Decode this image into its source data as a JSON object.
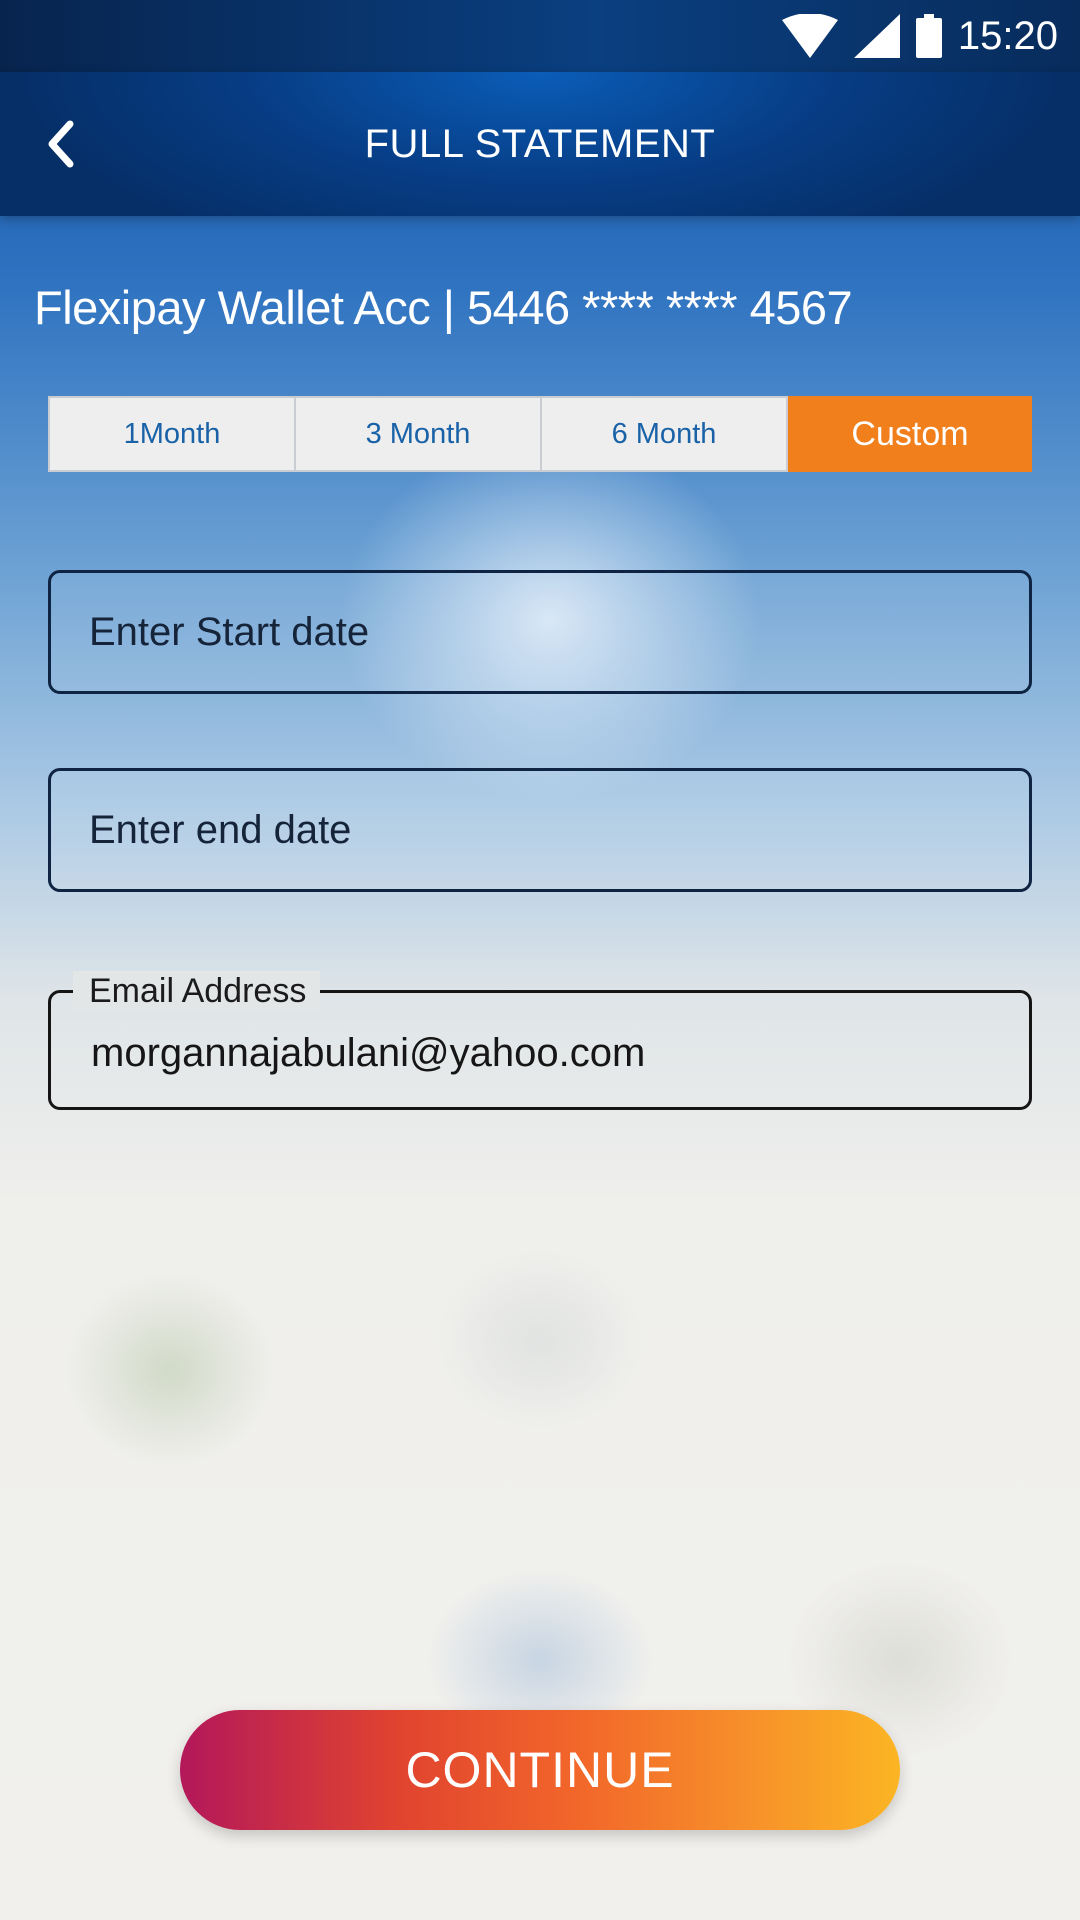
{
  "status_bar": {
    "time": "15:20"
  },
  "app_bar": {
    "title": "FULL STATEMENT"
  },
  "account": {
    "title": "Flexipay Wallet Acc | 5446 **** **** 4567"
  },
  "period_tabs": [
    {
      "label": "1Month",
      "active": false
    },
    {
      "label": "3 Month",
      "active": false
    },
    {
      "label": "6 Month",
      "active": false
    },
    {
      "label": "Custom",
      "active": true
    }
  ],
  "form": {
    "start_date_placeholder": "Enter Start date",
    "end_date_placeholder": "Enter end date",
    "email_label": "Email Address",
    "email_value": "morgannajabulani@yahoo.com"
  },
  "continue_label": "CONTINUE",
  "colors": {
    "header": "#073d85",
    "accent": "#f07f1c",
    "tab_text": "#1a62a8",
    "button_gradient_start": "#b3185a",
    "button_gradient_end": "#fbb523"
  },
  "icons": [
    "wifi-icon",
    "cell-signal-icon",
    "battery-icon",
    "back-arrow-icon"
  ]
}
